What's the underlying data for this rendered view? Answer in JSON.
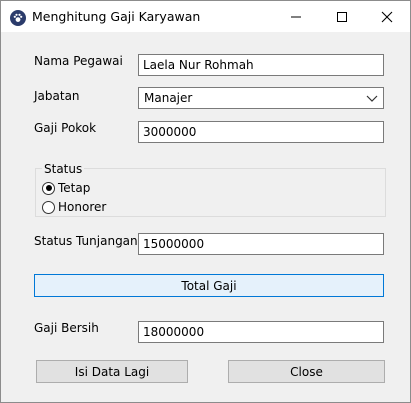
{
  "window": {
    "title": "Menghitung Gaji Karyawan",
    "app_icon": "paw-icon"
  },
  "form": {
    "nama_label": "Nama Pegawai",
    "nama_value": "Laela Nur Rohmah",
    "jabatan_label": "Jabatan",
    "jabatan_value": "Manajer",
    "gaji_pokok_label": "Gaji Pokok",
    "gaji_pokok_value": "3000000",
    "status_group_label": "Status",
    "status_options": [
      "Tetap",
      "Honorer"
    ],
    "status_selected": "Tetap",
    "tunjangan_label": "Status Tunjangan",
    "tunjangan_value": "15000000",
    "total_button": "Total Gaji",
    "gaji_bersih_label": "Gaji Bersih",
    "gaji_bersih_value": "18000000",
    "isi_lagi_button": "Isi Data Lagi",
    "close_button": "Close"
  },
  "colors": {
    "focus_border": "#0078d7",
    "focus_fill": "#e5f1fb"
  }
}
